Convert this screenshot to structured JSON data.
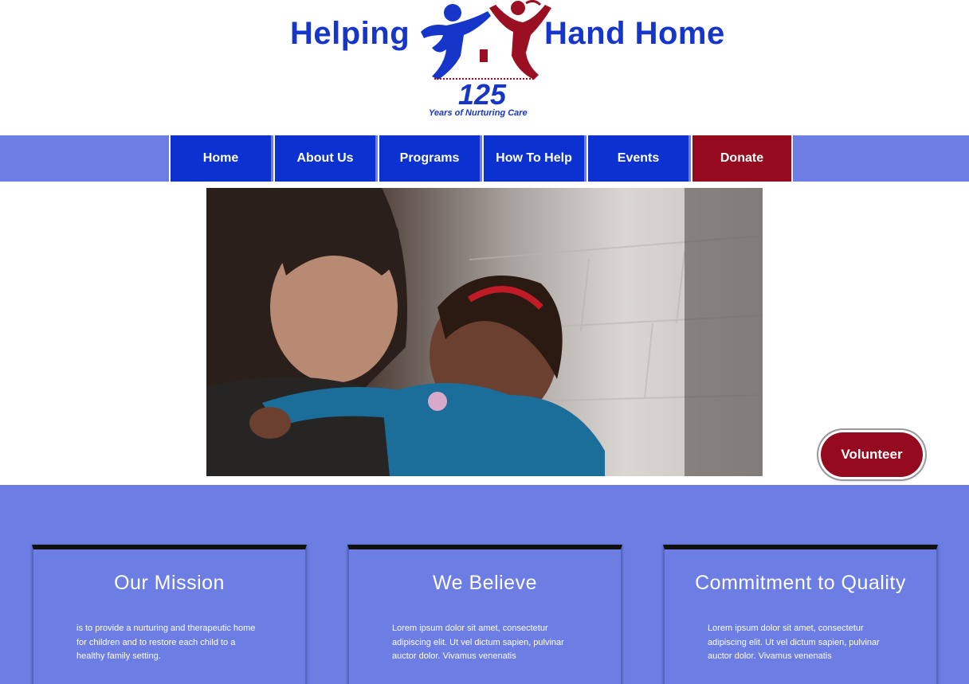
{
  "logo": {
    "word_left": "Helping",
    "word_right": "Hand Home",
    "anniversary": "125",
    "tagline": "Years of Nurturing Care",
    "colors": {
      "blue": "#1636c9",
      "red": "#9b0f22"
    }
  },
  "nav": {
    "items": [
      {
        "label": "Home"
      },
      {
        "label": "About Us"
      },
      {
        "label": "Programs"
      },
      {
        "label": "How To Help"
      },
      {
        "label": "Events"
      },
      {
        "label": "Donate"
      }
    ],
    "colors": {
      "bar": "#6c7de3",
      "item": "#0b32d0",
      "donate": "#960a1f"
    }
  },
  "hero": {
    "image": "photo-woman-hugging-child"
  },
  "volunteer_button": {
    "label": "Volunteer"
  },
  "cards": [
    {
      "title": "Our Mission",
      "body": "is to provide a nurturing and therapeutic home for children and to restore each child to a healthy family setting."
    },
    {
      "title": "We Believe",
      "body": "Lorem ipsum dolor sit amet, consectetur adipiscing elit. Ut vel dictum sapien, pulvinar auctor dolor. Vivamus venenatis"
    },
    {
      "title": "Commitment to Quality",
      "body": "Lorem ipsum dolor sit amet, consectetur adipiscing elit. Ut vel dictum sapien, pulvinar auctor dolor. Vivamus venenatis"
    }
  ]
}
